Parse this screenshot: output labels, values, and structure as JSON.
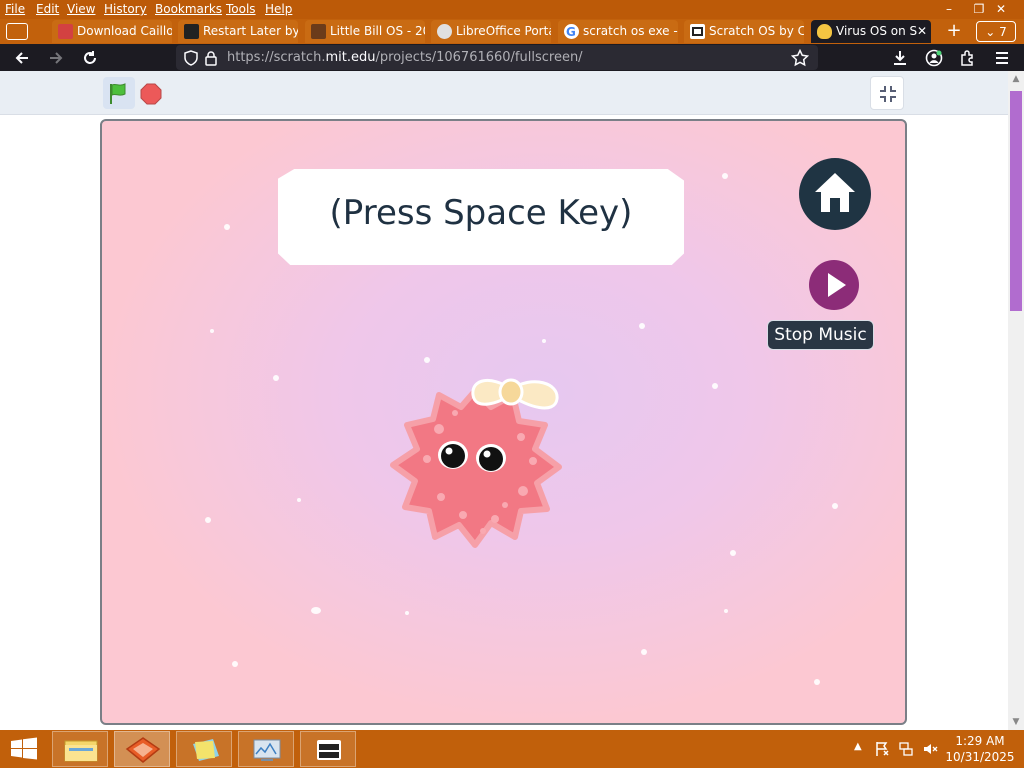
{
  "menubar": {
    "items": [
      "File",
      "Edit",
      "View",
      "History",
      "Bookmarks",
      "Tools",
      "Help"
    ]
  },
  "window_controls": {
    "minimize": "–",
    "restore": "❐",
    "close": "✕"
  },
  "tabs": [
    {
      "label": "Download Caillo",
      "icon": "caillou-favicon-icon",
      "icon_color": "#d34141"
    },
    {
      "label": "Restart Later by",
      "icon": "monitor-favicon-icon",
      "icon_color": "#222222"
    },
    {
      "label": "Little Bill OS - 20",
      "icon": "little-bill-favicon-icon",
      "icon_color": "#6b3b1a"
    },
    {
      "label": "LibreOffice Porta",
      "icon": "libreoffice-favicon-icon",
      "icon_color": "#e0e0e0"
    },
    {
      "label": "scratch os exe -",
      "icon": "google-favicon-icon",
      "icon_color": "#4285f4"
    },
    {
      "label": "Scratch OS by C",
      "icon": "scratch-favicon-icon",
      "icon_color": "#222222"
    },
    {
      "label": "Virus OS on S",
      "icon": "scratch-cat-favicon-icon",
      "icon_color": "#f4c542",
      "active": true
    }
  ],
  "tab_overflow": "7",
  "navbar": {
    "url_prefix": "https://scratch.",
    "url_domain": "mit.edu",
    "url_path": "/projects/106761660/fullscreen/"
  },
  "stage": {
    "prompt": "(Press Space Key)",
    "stop_music_label": "Stop Music"
  },
  "taskbar": {
    "time": "1:29 AM",
    "date": "10/31/2025"
  },
  "colors": {
    "firefox_theme_orange": "#c1600b",
    "toolbar_dark": "#1c1b22",
    "home_button": "#1f3443",
    "play_button": "#8c2c78",
    "monster_pink": "#f27884"
  }
}
